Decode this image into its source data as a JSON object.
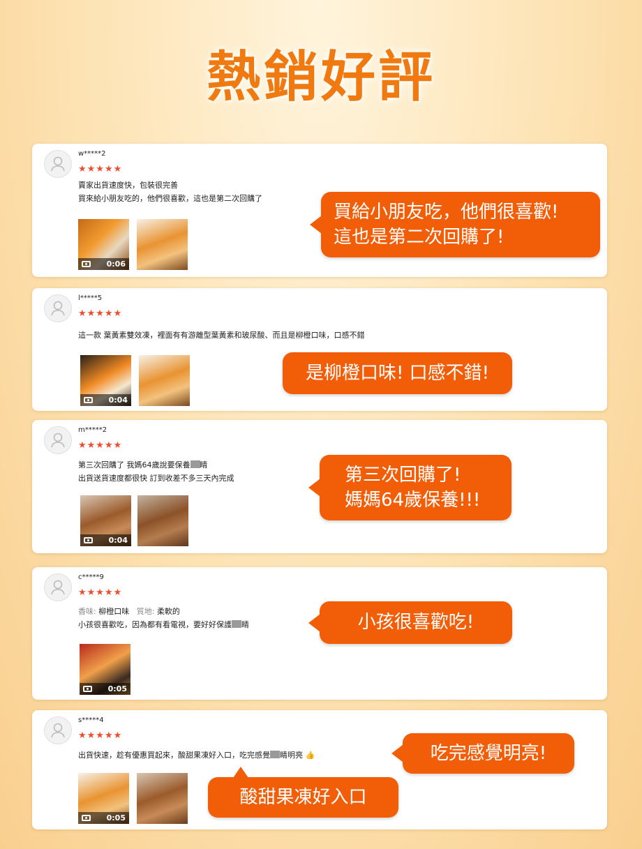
{
  "page": {
    "title": "熱銷好評"
  },
  "reviews": [
    {
      "username": "w*****2",
      "stars": "★★★★★",
      "lines": [
        "賣家出貨速度快，包裝很完善",
        "買來給小朋友吃的，他們很喜歡，這也是第二次回購了"
      ],
      "video_duration": "0:06",
      "callout": [
        "買給小朋友吃，他們很喜歡!",
        "這也是第二次回購了!"
      ]
    },
    {
      "username": "l*****5",
      "stars": "★★★★★",
      "lines": [
        "這一款 葉黃素雙效凍，裡面有有游離型葉黃素和玻尿酸、而且是柳橙口味，口感不錯"
      ],
      "video_duration": "0:04",
      "callout": [
        "是柳橙口味! 口感不錯!"
      ]
    },
    {
      "username": "m*****2",
      "stars": "★★★★★",
      "lines_a": [
        "第三次回購了  我媽64歲說要保養",
        "睛"
      ],
      "line_b": "出貨送貨速度都很快  訂到收差不多三天內完成",
      "video_duration": "0:04",
      "callout": [
        "第三次回購了!",
        "媽媽64歲保養!!!"
      ]
    },
    {
      "username": "c*****9",
      "stars": "★★★★★",
      "attr1_label": "香味:",
      "attr1_value": "柳橙口味",
      "attr2_label": "質地:",
      "attr2_value": "柔軟的",
      "line_a": [
        "小孩很喜歡吃，因為都有看電視，要好好保護",
        "睛"
      ],
      "video_duration": "0:05",
      "callout": [
        "小孩很喜歡吃!"
      ]
    },
    {
      "username": "s*****4",
      "stars": "★★★★★",
      "line_a": [
        "出貨快速，趁有優惠買起來，酸甜果凍好入口，吃完感覺",
        "睛明亮"
      ],
      "emoji": "👍",
      "video_duration": "0:05",
      "callout": [
        "吃完感覺明亮!"
      ],
      "callout2": [
        "酸甜果凍好入口"
      ]
    }
  ],
  "colors": {
    "accent": "#f25e08",
    "star": "#ee4d2d",
    "title": "#f07a10"
  },
  "icons": {
    "avatar": "user-icon",
    "video": "video-camera-icon",
    "thumbs_up": "thumbs-up-icon"
  }
}
